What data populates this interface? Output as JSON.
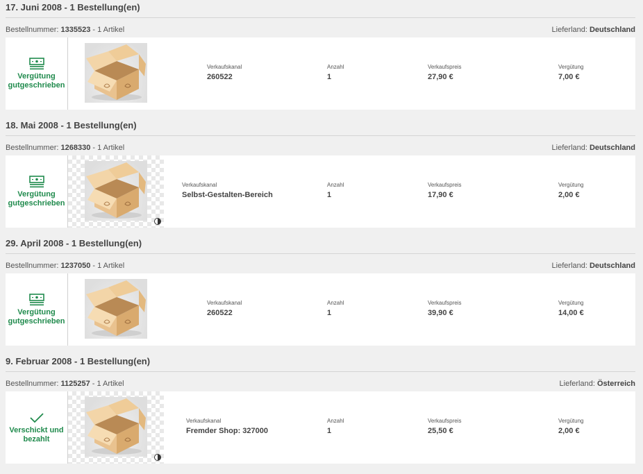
{
  "labels": {
    "order_number": "Bestellnummer:",
    "delivery_country": "Lieferland:",
    "sales_channel": "Verkaufskanal",
    "quantity": "Anzahl",
    "sale_price": "Verkaufspreis",
    "commission": "Vergütung"
  },
  "colors": {
    "status_green": "#1f8a4c",
    "background": "#f0f0f0"
  },
  "orders": [
    {
      "date_header": "17. Juni 2008 - 1 Bestellung(en)",
      "order_number": "1335523",
      "articles": "- 1 Artikel",
      "country": "Deutschland",
      "status_icon": "money-icon",
      "status_line1": "Vergütung",
      "status_line2": "gutgeschrieben",
      "thumb_icon": "box-icon",
      "sales_channel": "260522",
      "quantity": "1",
      "price": "27,90 €",
      "commission": "7,00 €"
    },
    {
      "date_header": "18. Mai 2008 - 1 Bestellung(en)",
      "order_number": "1268330",
      "articles": "- 1 Artikel",
      "country": "Deutschland",
      "status_icon": "money-icon",
      "status_line1": "Vergütung",
      "status_line2": "gutgeschrieben",
      "thumb_icon": "box-icon",
      "sales_channel": "Selbst-Gestalten-Bereich",
      "quantity": "1",
      "price": "17,90 €",
      "commission": "2,00 €"
    },
    {
      "date_header": "29. April 2008 - 1 Bestellung(en)",
      "order_number": "1237050",
      "articles": "- 1 Artikel",
      "country": "Deutschland",
      "status_icon": "money-icon",
      "status_line1": "Vergütung",
      "status_line2": "gutgeschrieben",
      "thumb_icon": "box-icon",
      "sales_channel": "260522",
      "quantity": "1",
      "price": "39,90 €",
      "commission": "14,00 €"
    },
    {
      "date_header": "9. Februar 2008 - 1 Bestellung(en)",
      "order_number": "1125257",
      "articles": "- 1 Artikel",
      "country": "Österreich",
      "status_icon": "checkmark-icon",
      "status_line1": "Verschickt und",
      "status_line2": "bezahlt",
      "thumb_icon": "box-icon",
      "sales_channel": "Fremder Shop: 327000",
      "quantity": "1",
      "price": "25,50 €",
      "commission": "2,00 €"
    }
  ]
}
